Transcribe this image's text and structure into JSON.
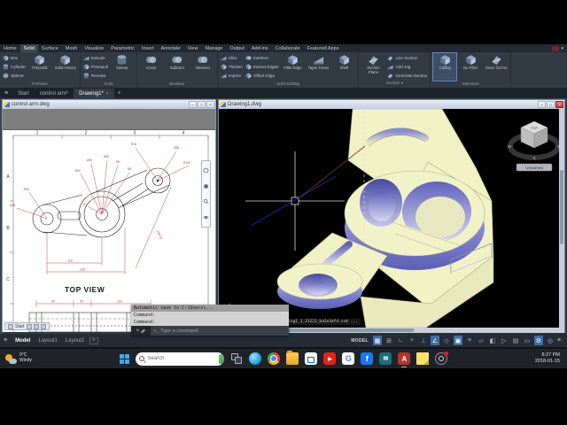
{
  "glyphs": {
    "close": "×",
    "minimize": "–",
    "maximize": "□",
    "plus": "+",
    "caret": "▾",
    "hamburger": "≡"
  },
  "ribbon": {
    "tabs": [
      {
        "label": "Home"
      },
      {
        "label": "Solid"
      },
      {
        "label": "Surface"
      },
      {
        "label": "Mesh"
      },
      {
        "label": "Visualize"
      },
      {
        "label": "Parametric"
      },
      {
        "label": "Insert"
      },
      {
        "label": "Annotate"
      },
      {
        "label": "View"
      },
      {
        "label": "Manage"
      },
      {
        "label": "Output"
      },
      {
        "label": "Add-ins"
      },
      {
        "label": "Collaborate"
      },
      {
        "label": "Featured Apps"
      }
    ],
    "active_tab": "Solid",
    "panels": [
      {
        "label": "Primitive",
        "buttons": [
          "Box",
          "Cylinder",
          "Sphere",
          "Polysolid",
          "Solid History"
        ]
      },
      {
        "label": "Solid",
        "buttons": [
          "Extrude",
          "Presspull",
          "Revolve",
          "Sweep"
        ]
      },
      {
        "label": "Boolean",
        "buttons": [
          "Union",
          "Subtract",
          "Intersect"
        ]
      },
      {
        "label": "Solid Editing",
        "buttons": [
          "Slice",
          "Thicken",
          "Imprint",
          "Interfere",
          "Extract Edges",
          "Offset Edge",
          "Fillet Edge",
          "Taper Faces",
          "Shell"
        ]
      },
      {
        "label": "Section ▾",
        "buttons": [
          "Section Plane",
          "Live Section",
          "Add Jog",
          "Generate Section"
        ]
      },
      {
        "label": "Selection",
        "buttons": [
          "Culling",
          "No Filter",
          "Move Gizmo"
        ]
      }
    ]
  },
  "file_tabs": {
    "items": [
      {
        "label": "Start"
      },
      {
        "label": "control arm*"
      },
      {
        "label": "Drawing1*"
      }
    ],
    "new_tab": "+"
  },
  "left_window": {
    "title": "control arm.dwg",
    "ruler_numbers": [
      "1",
      "2",
      "3",
      "4"
    ],
    "zone_letters": [
      "A",
      "B",
      "C"
    ],
    "view_label": "TOP VIEW",
    "dims": {
      "width1": "110",
      "width2": "130",
      "diagonal": "140.62",
      "bottom1": "60",
      "bottom2": "30",
      "bottom3": "100",
      "r_left": "R30",
      "d_left": "Ø15",
      "r_big": "R50",
      "d_mid": "Ø30",
      "d_big": "Ø50",
      "r_fillet": "R8",
      "r_small": "R5",
      "offset": "15",
      "r_top": "R18",
      "d_top": "Ø36",
      "r_arc": "R100"
    },
    "minibar": {
      "label": "Start"
    }
  },
  "right_window": {
    "title": "Drawing1.dwg",
    "viewcube": {
      "face": "TOP",
      "north": "N",
      "east": "E",
      "south": "S",
      "west": "W",
      "ucs_label": "Unnamed"
    },
    "cursor_label": "x",
    "autosave_path": "...\\AppData\\Local\\Temp\\Drawing1_1_21221_ba2e3afd.sv$ ..."
  },
  "command_panel": {
    "history": [
      "Automatic save to C:\\Users\\...",
      "Command:",
      "Command:"
    ],
    "placeholder": "Type a command"
  },
  "status_bar": {
    "model_badge": "MODEL",
    "tabs": [
      {
        "label": "Model"
      },
      {
        "label": "Layout1"
      },
      {
        "label": "Layout2"
      }
    ],
    "add_tab": "+",
    "icons": [
      {
        "name": "grid",
        "glyph": "▦"
      },
      {
        "name": "snap",
        "glyph": "⊞"
      },
      {
        "name": "infer",
        "glyph": "∟"
      },
      {
        "name": "dynamic-input",
        "glyph": "+"
      },
      {
        "name": "ortho",
        "glyph": "⊥"
      },
      {
        "name": "polar",
        "glyph": "∠"
      },
      {
        "name": "isodraft",
        "glyph": "◇"
      },
      {
        "name": "osnap",
        "glyph": "▣"
      },
      {
        "name": "lineweight",
        "glyph": "≡"
      },
      {
        "name": "transparency",
        "glyph": "▱"
      },
      {
        "name": "cycling",
        "glyph": "◧"
      },
      {
        "name": "osnap-3d",
        "glyph": "▷"
      },
      {
        "name": "dynamic-ucs",
        "glyph": "▤"
      },
      {
        "name": "annotation",
        "glyph": "▭"
      },
      {
        "name": "workspace",
        "glyph": "⚙"
      },
      {
        "name": "isolate",
        "glyph": "◎"
      }
    ]
  },
  "taskbar": {
    "weather_temp": "9°C",
    "weather_desc": "Windy",
    "search_placeholder": "Search",
    "time": "8:27 PM",
    "date": "2018-01-15",
    "app_glyphs": {
      "youtube": "▶",
      "google": "G",
      "facebook": "f",
      "mail": "✉",
      "autocad": "A"
    }
  }
}
